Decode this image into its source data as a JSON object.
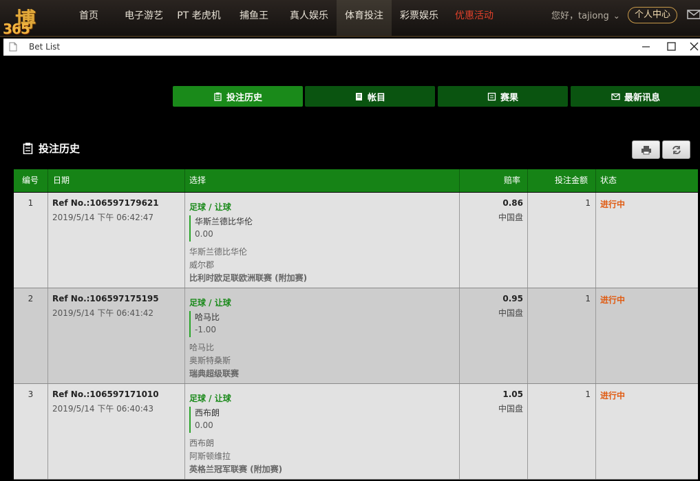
{
  "nav": {
    "logo_char": "博",
    "logo_text": "365",
    "items": [
      {
        "label": "首页"
      },
      {
        "label": "电子游艺"
      },
      {
        "label": "PT 老虎机"
      },
      {
        "label": "捕鱼王"
      },
      {
        "label": "真人娱乐"
      },
      {
        "label": "体育投注"
      },
      {
        "label": "彩票娱乐"
      },
      {
        "label": "优惠活动"
      }
    ],
    "greeting": "您好，tajiong",
    "user_center": "个人中心",
    "promo_color": "#e0402a"
  },
  "window": {
    "title": "Bet List"
  },
  "tabs": [
    {
      "label": "投注历史",
      "icon": "clipboard-icon",
      "active": true
    },
    {
      "label": "帐目",
      "icon": "ledger-icon",
      "active": false
    },
    {
      "label": "赛果",
      "icon": "scoreboard-icon",
      "active": false
    },
    {
      "label": "最新讯息",
      "icon": "envelope-icon",
      "active": false
    }
  ],
  "section": {
    "title": "投注历史"
  },
  "table": {
    "headers": {
      "num": "编号",
      "date": "日期",
      "selection": "选择",
      "odds": "赔率",
      "amount": "投注金额",
      "status": "状态"
    },
    "rows": [
      {
        "num": "1",
        "ref": "Ref No.:106597179621",
        "date": "2019/5/14 下午 06:42:47",
        "market": "足球 / 让球",
        "pick": "华斯兰德比华伦",
        "handicap": "0.00",
        "home": "华斯兰德比华伦",
        "away": "威尔郡",
        "league": "比利时欧足联欧洲联赛 (附加赛)",
        "odds": "0.86",
        "odds_type": "中国盘",
        "amount": "1",
        "status": "进行中"
      },
      {
        "num": "2",
        "ref": "Ref No.:106597175195",
        "date": "2019/5/14 下午 06:41:42",
        "market": "足球 / 让球",
        "pick": "哈马比",
        "handicap": "-1.00",
        "home": "哈马比",
        "away": "奥斯特桑斯",
        "league": "瑞典超级联赛",
        "odds": "0.95",
        "odds_type": "中国盘",
        "amount": "1",
        "status": "进行中"
      },
      {
        "num": "3",
        "ref": "Ref No.:106597171010",
        "date": "2019/5/14 下午 06:40:43",
        "market": "足球 / 让球",
        "pick": "西布朗",
        "handicap": "0.00",
        "home": "西布朗",
        "away": "阿斯顿维拉",
        "league": "英格兰冠军联赛 (附加赛)",
        "odds": "1.05",
        "odds_type": "中国盘",
        "amount": "1",
        "status": "进行中"
      }
    ]
  }
}
